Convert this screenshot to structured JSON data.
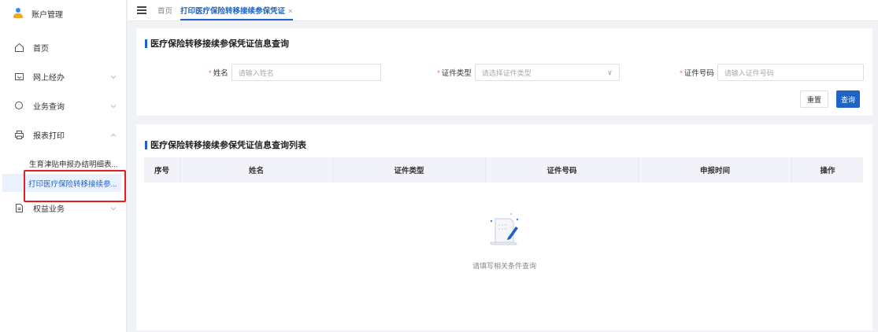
{
  "sidebar": {
    "header": "账户管理",
    "items": [
      {
        "label": "首页",
        "icon": "home-icon"
      },
      {
        "label": "网上经办",
        "icon": "inbox-icon",
        "chevron": "down"
      },
      {
        "label": "业务查询",
        "icon": "search-icon",
        "chevron": "down"
      },
      {
        "label": "报表打印",
        "icon": "printer-icon",
        "chevron": "up"
      },
      {
        "label": "权益业务",
        "icon": "document-icon",
        "chevron": "down"
      }
    ],
    "subitems": [
      {
        "label": "生育津贴申报办结明细表..."
      },
      {
        "label": "打印医疗保险转移接续参..."
      }
    ]
  },
  "topbar": {
    "tabs": [
      {
        "label": "首页"
      },
      {
        "label": "打印医疗保险转移接续参保凭证",
        "close": "×"
      }
    ]
  },
  "query_panel": {
    "title": "医疗保险转移接续参保凭证信息查询",
    "fields": [
      {
        "label": "姓名",
        "required": "*",
        "placeholder": "请输入姓名"
      },
      {
        "label": "证件类型",
        "required": "*",
        "placeholder": "请选择证件类型",
        "caret": "∨"
      },
      {
        "label": "证件号码",
        "required": "*",
        "placeholder": "请输入证件号码"
      }
    ],
    "reset_label": "重置",
    "query_label": "查询"
  },
  "list_panel": {
    "title": "医疗保险转移接续参保凭证信息查询列表",
    "columns": [
      "序号",
      "姓名",
      "证件类型",
      "证件号码",
      "申报时间",
      "操作"
    ],
    "rows": [],
    "empty_text": "请填写相关条件查询"
  },
  "colors": {
    "accent": "#1f63c6",
    "highlight_border": "#e02020",
    "required": "#f56c6c"
  }
}
